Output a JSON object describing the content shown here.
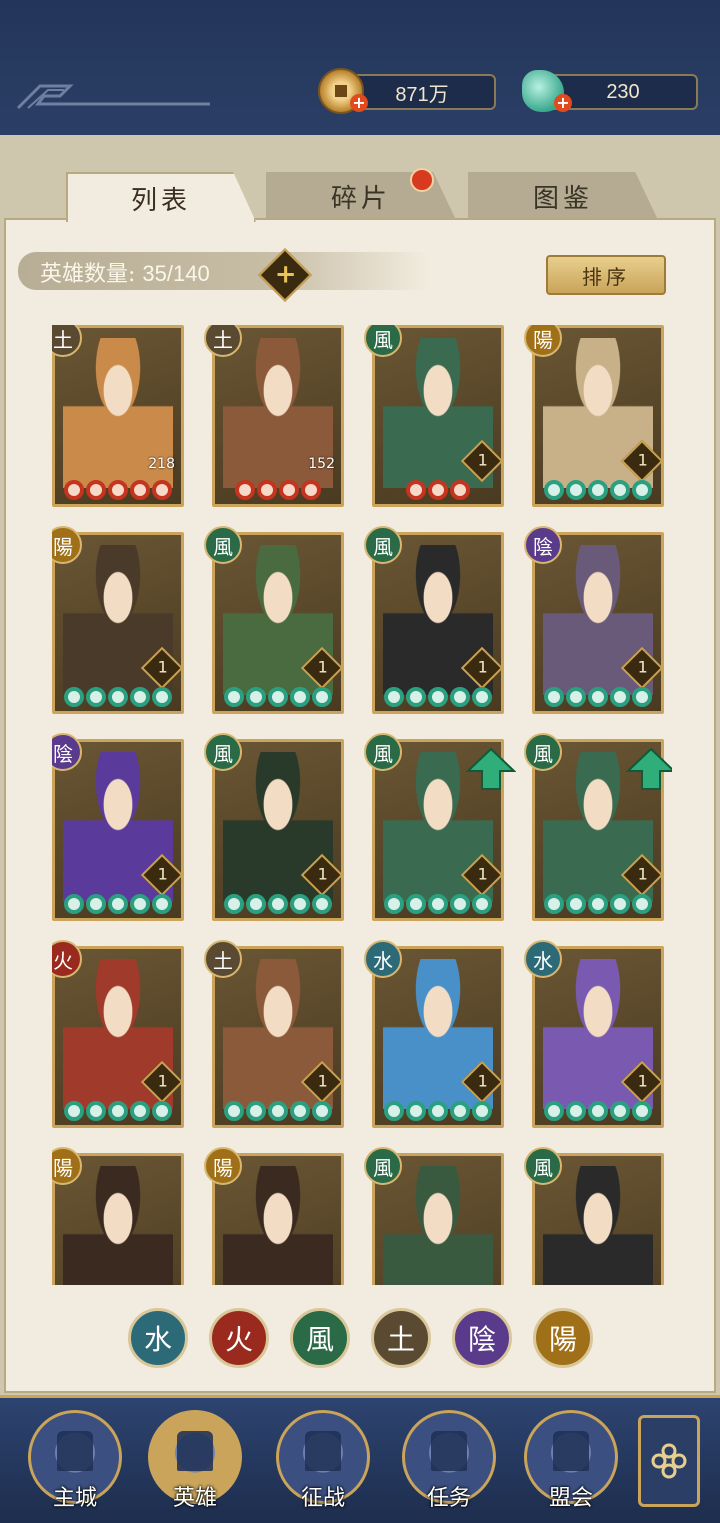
{
  "resources": {
    "coin": {
      "value": "871万",
      "icon": "coin-icon"
    },
    "jade": {
      "value": "230",
      "icon": "jade-icon"
    }
  },
  "tabs": [
    {
      "label": "列表",
      "active": true
    },
    {
      "label": "碎片",
      "active": false,
      "notification": true
    },
    {
      "label": "图鉴",
      "active": false
    }
  ],
  "hero_count": {
    "label": "英雄数量:",
    "value": "35/140"
  },
  "sort_label": "排序",
  "elements": {
    "water": {
      "glyph": "水",
      "color": "#2d6a78"
    },
    "fire": {
      "glyph": "火",
      "color": "#9a2a1e"
    },
    "wind": {
      "glyph": "風",
      "color": "#2a6a46"
    },
    "earth": {
      "glyph": "土",
      "color": "#5a4a32"
    },
    "yin": {
      "glyph": "陰",
      "color": "#5a3a8a"
    },
    "yang": {
      "glyph": "陽",
      "color": "#a07018"
    }
  },
  "heroes": [
    {
      "element": "earth",
      "level": "",
      "count": "218",
      "pieces": 5,
      "piece_color": "red",
      "upgrade": false
    },
    {
      "element": "earth",
      "level": "",
      "count": "152",
      "pieces": 4,
      "piece_color": "red",
      "upgrade": false
    },
    {
      "element": "wind",
      "level": "1",
      "count": "",
      "pieces": 3,
      "piece_color": "red",
      "upgrade": false
    },
    {
      "element": "yang",
      "level": "1",
      "count": "",
      "pieces": 5,
      "piece_color": "green",
      "upgrade": false
    },
    {
      "element": "yang",
      "level": "1",
      "count": "",
      "pieces": 5,
      "piece_color": "green",
      "upgrade": false
    },
    {
      "element": "wind",
      "level": "1",
      "count": "",
      "pieces": 5,
      "piece_color": "green",
      "upgrade": false
    },
    {
      "element": "wind",
      "level": "1",
      "count": "",
      "pieces": 5,
      "piece_color": "green",
      "upgrade": false
    },
    {
      "element": "yin",
      "level": "1",
      "count": "",
      "pieces": 5,
      "piece_color": "green",
      "upgrade": false
    },
    {
      "element": "yin",
      "level": "1",
      "count": "",
      "pieces": 5,
      "piece_color": "green",
      "upgrade": false
    },
    {
      "element": "wind",
      "level": "1",
      "count": "",
      "pieces": 5,
      "piece_color": "green",
      "upgrade": false
    },
    {
      "element": "wind",
      "level": "1",
      "count": "",
      "pieces": 5,
      "piece_color": "green",
      "upgrade": true
    },
    {
      "element": "wind",
      "level": "1",
      "count": "",
      "pieces": 5,
      "piece_color": "green",
      "upgrade": true
    },
    {
      "element": "fire",
      "level": "1",
      "count": "",
      "pieces": 5,
      "piece_color": "green",
      "upgrade": false
    },
    {
      "element": "earth",
      "level": "1",
      "count": "",
      "pieces": 5,
      "piece_color": "green",
      "upgrade": false
    },
    {
      "element": "water",
      "level": "1",
      "count": "",
      "pieces": 5,
      "piece_color": "green",
      "upgrade": false
    },
    {
      "element": "water",
      "level": "1",
      "count": "",
      "pieces": 5,
      "piece_color": "green",
      "upgrade": false
    },
    {
      "element": "yang",
      "level": "",
      "count": "",
      "pieces": 0,
      "piece_color": "green",
      "upgrade": false
    },
    {
      "element": "yang",
      "level": "",
      "count": "",
      "pieces": 0,
      "piece_color": "green",
      "upgrade": false
    },
    {
      "element": "wind",
      "level": "",
      "count": "",
      "pieces": 0,
      "piece_color": "green",
      "upgrade": false
    },
    {
      "element": "wind",
      "level": "",
      "count": "",
      "pieces": 0,
      "piece_color": "green",
      "upgrade": false
    }
  ],
  "element_filters": [
    "water",
    "fire",
    "wind",
    "earth",
    "yin",
    "yang"
  ],
  "nav": [
    {
      "label": "主城",
      "icon": "castle-icon"
    },
    {
      "label": "英雄",
      "icon": "hero-portrait-icon",
      "active": true
    },
    {
      "label": "征战",
      "icon": "battle-icon"
    },
    {
      "label": "任务",
      "icon": "scroll-icon"
    },
    {
      "label": "盟会",
      "icon": "alliance-gate-icon"
    }
  ],
  "menu_icon": "menu-flower-icon"
}
